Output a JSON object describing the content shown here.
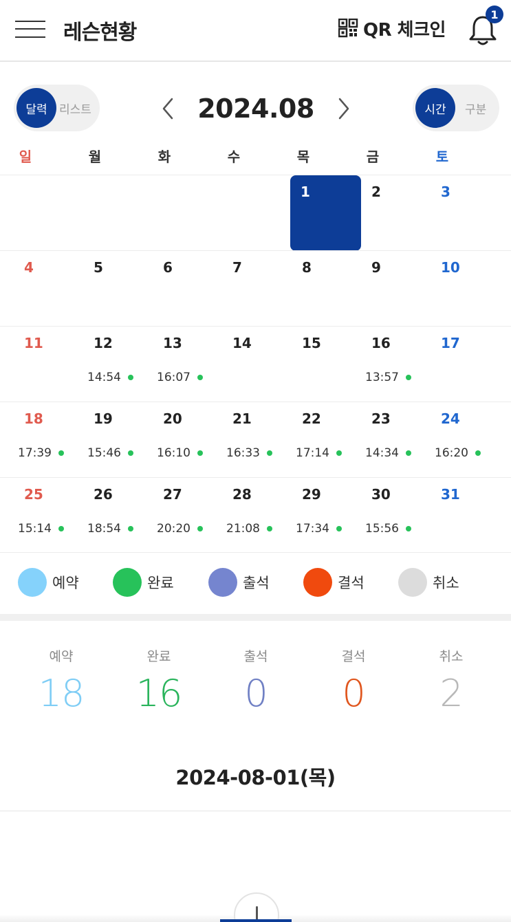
{
  "header": {
    "title": "레슨현황",
    "qr_label": "QR 체크인",
    "notification_count": "1",
    "icons": {
      "menu": "hamburger-icon",
      "qr": "qr-code-icon",
      "bell": "bell-icon"
    }
  },
  "toolbar": {
    "view_toggle": {
      "active": "달력",
      "inactive": "리스트"
    },
    "mode_toggle": {
      "active": "시간",
      "inactive": "구분"
    },
    "month": "2024.08",
    "prev_icon": "chevron-left-icon",
    "next_icon": "chevron-right-icon"
  },
  "calendar": {
    "weekdays": [
      "일",
      "월",
      "화",
      "수",
      "목",
      "금",
      "토"
    ],
    "weekday_colors": {
      "sun": "#e05a4e",
      "sat": "#2067cf",
      "weekday": "#333333"
    },
    "selected_day": "1",
    "weeks": [
      [
        {
          "day": ""
        },
        {
          "day": ""
        },
        {
          "day": ""
        },
        {
          "day": ""
        },
        {
          "day": "1"
        },
        {
          "day": "2"
        },
        {
          "day": "3"
        }
      ],
      [
        {
          "day": "4"
        },
        {
          "day": "5"
        },
        {
          "day": "6"
        },
        {
          "day": "7"
        },
        {
          "day": "8"
        },
        {
          "day": "9"
        },
        {
          "day": "10"
        }
      ],
      [
        {
          "day": "11"
        },
        {
          "day": "12",
          "time": "14:54"
        },
        {
          "day": "13",
          "time": "16:07"
        },
        {
          "day": "14"
        },
        {
          "day": "15"
        },
        {
          "day": "16",
          "time": "13:57"
        },
        {
          "day": "17"
        }
      ],
      [
        {
          "day": "18",
          "time": "17:39"
        },
        {
          "day": "19",
          "time": "15:46"
        },
        {
          "day": "20",
          "time": "16:10"
        },
        {
          "day": "21",
          "time": "16:33"
        },
        {
          "day": "22",
          "time": "17:14"
        },
        {
          "day": "23",
          "time": "14:34"
        },
        {
          "day": "24",
          "time": "16:20"
        }
      ],
      [
        {
          "day": "25",
          "time": "15:14"
        },
        {
          "day": "26",
          "time": "18:54"
        },
        {
          "day": "27",
          "time": "20:20"
        },
        {
          "day": "28",
          "time": "21:08"
        },
        {
          "day": "29",
          "time": "17:34"
        },
        {
          "day": "30",
          "time": "15:56"
        },
        {
          "day": "31"
        }
      ]
    ]
  },
  "legend": [
    {
      "label": "예약",
      "color": "#85d2fb"
    },
    {
      "label": "완료",
      "color": "#27c25a"
    },
    {
      "label": "출석",
      "color": "#7585cf"
    },
    {
      "label": "결석",
      "color": "#f04a0e"
    },
    {
      "label": "취소",
      "color": "#dcdcdc"
    }
  ],
  "stats": [
    {
      "label": "예약",
      "value": "18",
      "color": "#7fcdf5"
    },
    {
      "label": "완료",
      "value": "16",
      "color": "#2ab45c"
    },
    {
      "label": "출석",
      "value": "0",
      "color": "#7080c4"
    },
    {
      "label": "결석",
      "value": "0",
      "color": "#e0561e"
    },
    {
      "label": "취소",
      "value": "2",
      "color": "#b8b8b8"
    }
  ],
  "selected_date": "2024-08-01(목)",
  "accent_color": "#0d3d97"
}
